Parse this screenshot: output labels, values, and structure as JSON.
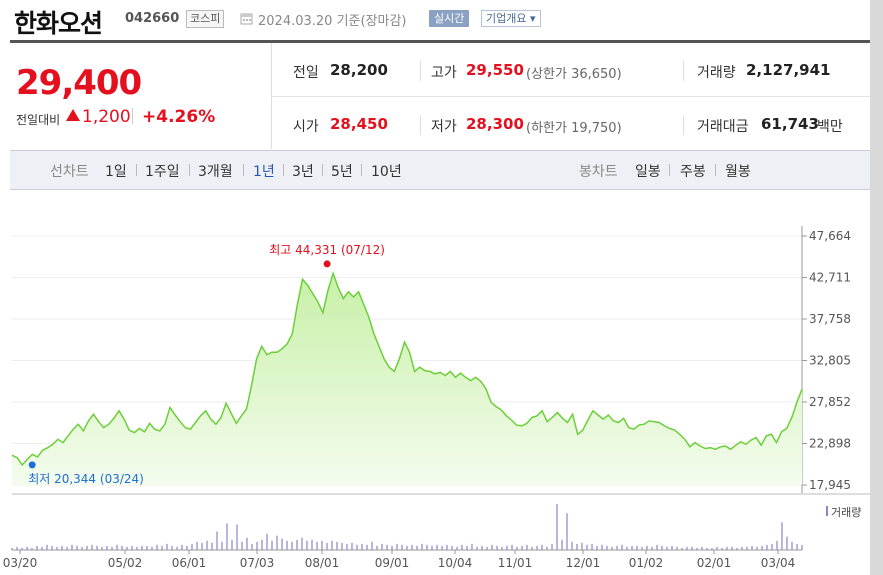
{
  "header": {
    "name": "한화오션",
    "code": "042660",
    "market": "코스피",
    "date": "2024.03.20 기준(장마감)",
    "realtime": "실시간",
    "company_info": "기업개요 ▾"
  },
  "price": {
    "current": "29,400",
    "change_label": "전일대비",
    "change_amount": "1,200",
    "change_rate": "+4.26%"
  },
  "stats": {
    "prev_close_label": "전일",
    "prev_close": "28,200",
    "high_label": "고가",
    "high": "29,550",
    "upper_limit": "(상한가 36,650)",
    "volume_label": "거래량",
    "volume": "2,127,941",
    "open_label": "시가",
    "open": "28,450",
    "low_label": "저가",
    "low": "28,300",
    "lower_limit": "(하한가 19,750)",
    "trade_value_label": "거래대금",
    "trade_value": "61,743",
    "trade_value_unit": "백만"
  },
  "periods": {
    "line_label": "선차트",
    "line_items": [
      "1일",
      "1주일",
      "3개월",
      "1년",
      "3년",
      "5년",
      "10년"
    ],
    "active": "1년",
    "candle_label": "봉차트",
    "candle_items": [
      "일봉",
      "주봉",
      "월봉"
    ]
  },
  "colors": {
    "up": "#e4101e",
    "down": "#1e6fd6",
    "area_line": "#6ccf3a",
    "area_fill": "#c8f0a8",
    "volume_bar": "#8c84c6"
  },
  "chart_data": {
    "type": "area",
    "yticks": [
      "47,664",
      "42,711",
      "37,758",
      "32,805",
      "27,852",
      "22,898",
      "17,945"
    ],
    "ylim": [
      17945,
      47664
    ],
    "xticks": [
      "03/20",
      "05/02",
      "06/01",
      "07/03",
      "08/01",
      "09/01",
      "10/04",
      "11/01",
      "12/01",
      "01/02",
      "02/01",
      "03/04"
    ],
    "max_label": "최고 44,331 (07/12)",
    "min_label": "최저 20,344 (03/24)",
    "max_value": 44331,
    "min_value": 20344,
    "volume_legend": "거래량",
    "series": [
      {
        "values": [
          21500,
          21200,
          20344,
          21000,
          21600,
          21300,
          22100,
          22400,
          22800,
          23400,
          23000,
          23800,
          24600,
          25200,
          24400,
          25600,
          26400,
          25500,
          24800,
          25200,
          25900,
          26800,
          25800,
          24500,
          24200,
          24700,
          24300,
          25300,
          24600,
          24400,
          25200,
          27200,
          26300,
          25500,
          24800,
          24600,
          25400,
          26200,
          26800,
          25800,
          25200,
          26000,
          27700,
          26500,
          25300,
          26200,
          27000,
          29800,
          33000,
          34500,
          33500,
          33800,
          33800,
          34200,
          34800,
          36000,
          39500,
          42500,
          41800,
          40800,
          39800,
          38500,
          41200,
          43200,
          41500,
          40200,
          41000,
          40400,
          41000,
          39500,
          38000,
          36000,
          34500,
          33000,
          32000,
          31500,
          33000,
          35000,
          33800,
          31500,
          32000,
          31600,
          31500,
          31200,
          31400,
          31000,
          31500,
          30800,
          31300,
          30800,
          30400,
          30800,
          30300,
          29400,
          27800,
          27300,
          26900,
          26200,
          25700,
          25100,
          25000,
          25300,
          26000,
          26200,
          26800,
          25500,
          26000,
          26600,
          25900,
          25400,
          26400,
          24000,
          24500,
          25700,
          26800,
          26300,
          25800,
          26300,
          25600,
          25400,
          25900,
          24800,
          24600,
          25100,
          25200,
          25600,
          25500,
          25400,
          25000,
          24700,
          24500,
          24000,
          23400,
          22500,
          23000,
          22600,
          22300,
          22400,
          22200,
          22500,
          22600,
          22200,
          22700,
          23100,
          22800,
          23300,
          23600,
          22700,
          23800,
          24000,
          23000,
          24300,
          24700,
          26000,
          27800,
          29400
        ]
      }
    ],
    "volume": [
      2,
      3,
      2,
      3,
      2,
      4,
      3,
      5,
      4,
      3,
      4,
      3,
      5,
      4,
      3,
      4,
      5,
      4,
      3,
      4,
      3,
      5,
      4,
      3,
      4,
      3,
      4,
      4,
      3,
      5,
      4,
      6,
      4,
      3,
      5,
      4,
      6,
      8,
      7,
      9,
      7,
      18,
      8,
      26,
      10,
      25,
      8,
      12,
      6,
      8,
      10,
      16,
      9,
      14,
      11,
      9,
      8,
      10,
      12,
      9,
      10,
      8,
      9,
      7,
      9,
      8,
      7,
      6,
      7,
      5,
      6,
      5,
      8,
      4,
      6,
      5,
      4,
      6,
      5,
      4,
      5,
      4,
      6,
      5,
      4,
      5,
      4,
      5,
      4,
      3,
      5,
      4,
      6,
      3,
      4,
      3,
      5,
      4,
      3,
      4,
      5,
      3,
      4,
      5,
      3,
      4,
      5,
      3,
      6,
      45,
      10,
      36,
      8,
      6,
      7,
      5,
      6,
      4,
      5,
      4,
      3,
      4,
      5,
      3,
      4,
      4,
      3,
      4,
      3,
      5,
      4,
      3,
      4,
      3,
      2,
      3,
      3,
      2,
      3,
      2,
      2,
      3,
      2,
      3,
      3,
      2,
      3,
      3,
      4,
      3,
      4,
      5,
      6,
      9,
      27,
      13,
      8,
      6,
      5
    ]
  }
}
